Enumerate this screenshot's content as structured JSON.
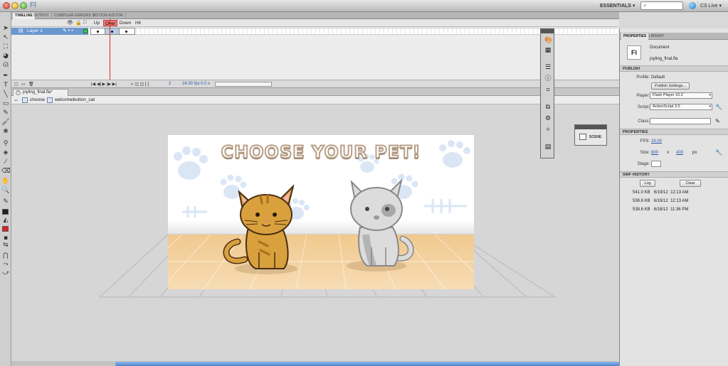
{
  "app": {
    "logo": "Fl",
    "workspace": "ESSENTIALS ▾",
    "cs_live": "CS Live ▾"
  },
  "panel_tabs": [
    "TIMELINE",
    "OUTPUT",
    "COMPILER ERRORS",
    "MOTION EDITOR"
  ],
  "timeline": {
    "frame_labels": [
      "Up",
      "Over",
      "Down",
      "Hit"
    ],
    "selected_frame": "Over",
    "layer_name": "Layer 1",
    "current_frame": "2",
    "fps": "24.00 fps",
    "elapsed": "0.0 s"
  },
  "document_tab": "joyling_final.fla*",
  "breadcrumb": {
    "scene": "choose",
    "symbol": "welcomebutton_cat"
  },
  "stage": {
    "title": "CHOOSE YOUR PET!"
  },
  "scene_panel_label": "SCENE",
  "properties": {
    "tabs": [
      "PROPERTIES",
      "LIBRARY"
    ],
    "badge": "Fl",
    "doc_type": "Document",
    "doc_name": "joyling_final.fla",
    "publish": {
      "section": "PUBLISH",
      "profile_label": "Profile:",
      "profile_value": "Default",
      "settings_button": "Publish Settings...",
      "player_label": "Player:",
      "player_value": "Flash Player 10.2",
      "script_label": "Script:",
      "script_value": "ActionScript 3.0",
      "class_label": "Class:"
    },
    "props": {
      "section": "PROPERTIES",
      "fps_label": "FPS:",
      "fps_value": "24.00",
      "size_label": "Size:",
      "width": "800",
      "x": "x",
      "height": "400",
      "unit": "px",
      "stage_label": "Stage:"
    },
    "swf_history": {
      "section": "SWF HISTORY",
      "log_button": "Log",
      "clear_button": "Clear",
      "rows": [
        {
          "size": "541.0 KB",
          "date": "6/19/12",
          "time": "12:13 AM"
        },
        {
          "size": "538.6 KB",
          "date": "6/19/12",
          "time": "12:13 AM"
        },
        {
          "size": "538.6 KB",
          "date": "6/18/12",
          "time": "11:36 PM"
        }
      ]
    }
  },
  "colors": {
    "layer_highlight": "#6b97cf",
    "selected_frame": "#f07a7a",
    "playhead": "#e02424",
    "stroke_swatch": "#222222",
    "fill_swatch": "#e02020",
    "floor": "#f0c98e",
    "paw_prints": "#dbe6f5"
  },
  "icons": [
    "search-icon",
    "pencil-icon",
    "eye-icon",
    "lock-icon",
    "outline-icon",
    "wrench-icon",
    "scene-icon"
  ]
}
